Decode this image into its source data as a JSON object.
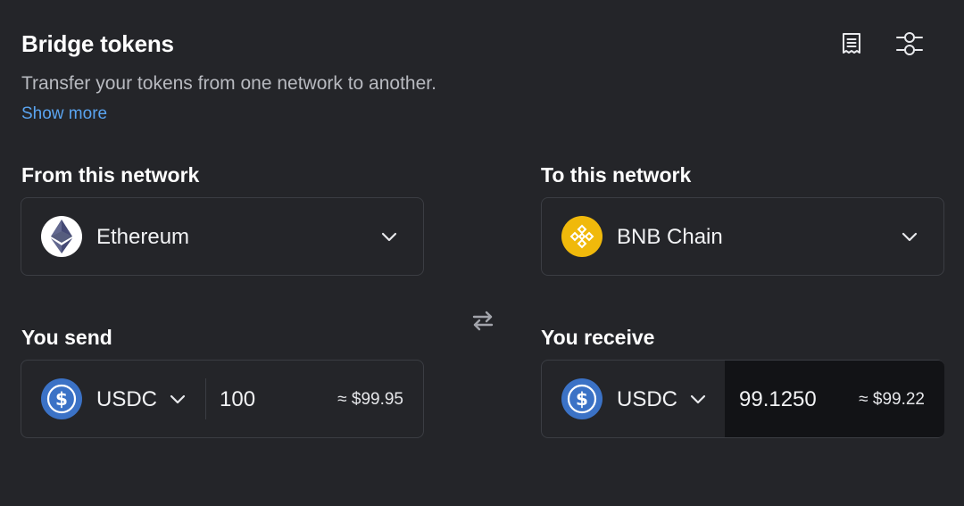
{
  "header": {
    "title": "Bridge tokens",
    "subtitle": "Transfer your tokens from one network to another.",
    "show_more": "Show more",
    "icons": [
      "receipt-icon",
      "settings-sliders-icon"
    ]
  },
  "from": {
    "label": "From this network",
    "network": {
      "name": "Ethereum",
      "icon": "ethereum-icon"
    }
  },
  "to": {
    "label": "To this network",
    "network": {
      "name": "BNB Chain",
      "icon": "bnb-icon"
    }
  },
  "send": {
    "label": "You send",
    "token": "USDC",
    "token_icon": "usdc-icon",
    "amount": "100",
    "fiat": "≈ $99.95"
  },
  "receive": {
    "label": "You receive",
    "token": "USDC",
    "token_icon": "usdc-icon",
    "amount": "99.1250",
    "fiat": "≈ $99.22"
  },
  "colors": {
    "background": "#242529",
    "border": "#3b3d43",
    "link": "#5aa4f0",
    "usdc": "#3b72c6",
    "bnb": "#f0b90b"
  }
}
